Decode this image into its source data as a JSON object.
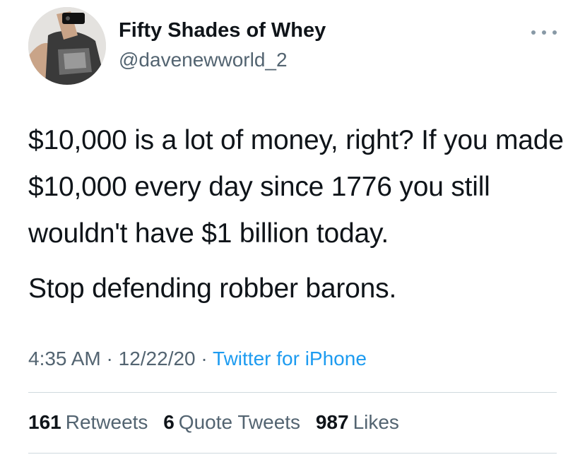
{
  "author": {
    "display_name": "Fifty Shades of Whey",
    "handle": "@davenewworld_2",
    "avatar_icon": "profile-photo"
  },
  "tweet": {
    "paragraph_1": "$10,000 is a lot of money, right? If you made $10,000 every day since 1776 you still wouldn't have $1 billion today.",
    "paragraph_2": "Stop defending robber barons."
  },
  "meta": {
    "time": "4:35 AM",
    "sep1": " · ",
    "date": "12/22/20",
    "sep2": " · ",
    "source": "Twitter for iPhone"
  },
  "stats": {
    "retweets_count": "161",
    "retweets_label": "Retweets",
    "quotes_count": "6",
    "quotes_label": "Quote Tweets",
    "likes_count": "987",
    "likes_label": "Likes"
  },
  "colors": {
    "text": "#0f1419",
    "secondary": "#536471",
    "link": "#1d9bf0",
    "divider": "#cfd9de"
  },
  "icons": {
    "more": "more-horizontal-icon"
  }
}
